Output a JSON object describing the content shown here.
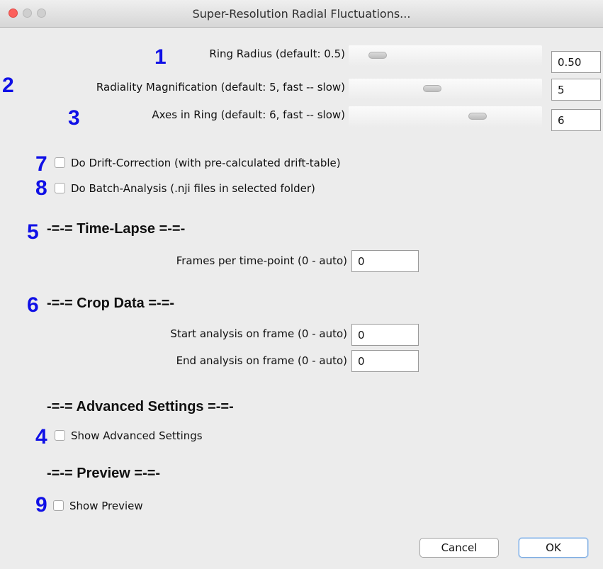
{
  "window": {
    "title": "Super-Resolution Radial Fluctuations..."
  },
  "annotations": {
    "ring_radius": "1",
    "magnification": "2",
    "axes": "3",
    "advanced": "4",
    "time_lapse": "5",
    "crop": "6",
    "drift": "7",
    "batch": "8",
    "preview": "9"
  },
  "sliders": {
    "ring_radius": {
      "label": "Ring Radius (default: 0.5)",
      "value": "0.50",
      "position": 0.08
    },
    "magnification": {
      "label": "Radiality Magnification (default: 5, fast -- slow)",
      "value": "5",
      "position": 0.42
    },
    "axes": {
      "label": "Axes in Ring (default: 6, fast -- slow)",
      "value": "6",
      "position": 0.7
    }
  },
  "checkboxes": {
    "drift": {
      "label": "Do Drift-Correction (with pre-calculated drift-table)",
      "checked": false
    },
    "batch": {
      "label": "Do Batch-Analysis (.nji files in selected folder)",
      "checked": false
    },
    "advanced": {
      "label": "Show Advanced Settings",
      "checked": false
    },
    "preview": {
      "label": "Show Preview",
      "checked": false
    }
  },
  "sections": {
    "time_lapse": {
      "heading": "-=-= Time-Lapse =-=-",
      "frames_label": "Frames per time-point (0 - auto)",
      "frames_value": "0"
    },
    "crop": {
      "heading": "-=-= Crop Data =-=-",
      "start_label": "Start analysis on frame (0 - auto)",
      "start_value": "0",
      "end_label": "End analysis on frame (0 - auto)",
      "end_value": "0"
    },
    "advanced": {
      "heading": "-=-= Advanced Settings =-=-"
    },
    "preview": {
      "heading": "-=-= Preview =-=-"
    }
  },
  "buttons": {
    "cancel": "Cancel",
    "ok": "OK"
  },
  "colors": {
    "annotation": "#1010e6",
    "close_light": "#fc605c"
  }
}
